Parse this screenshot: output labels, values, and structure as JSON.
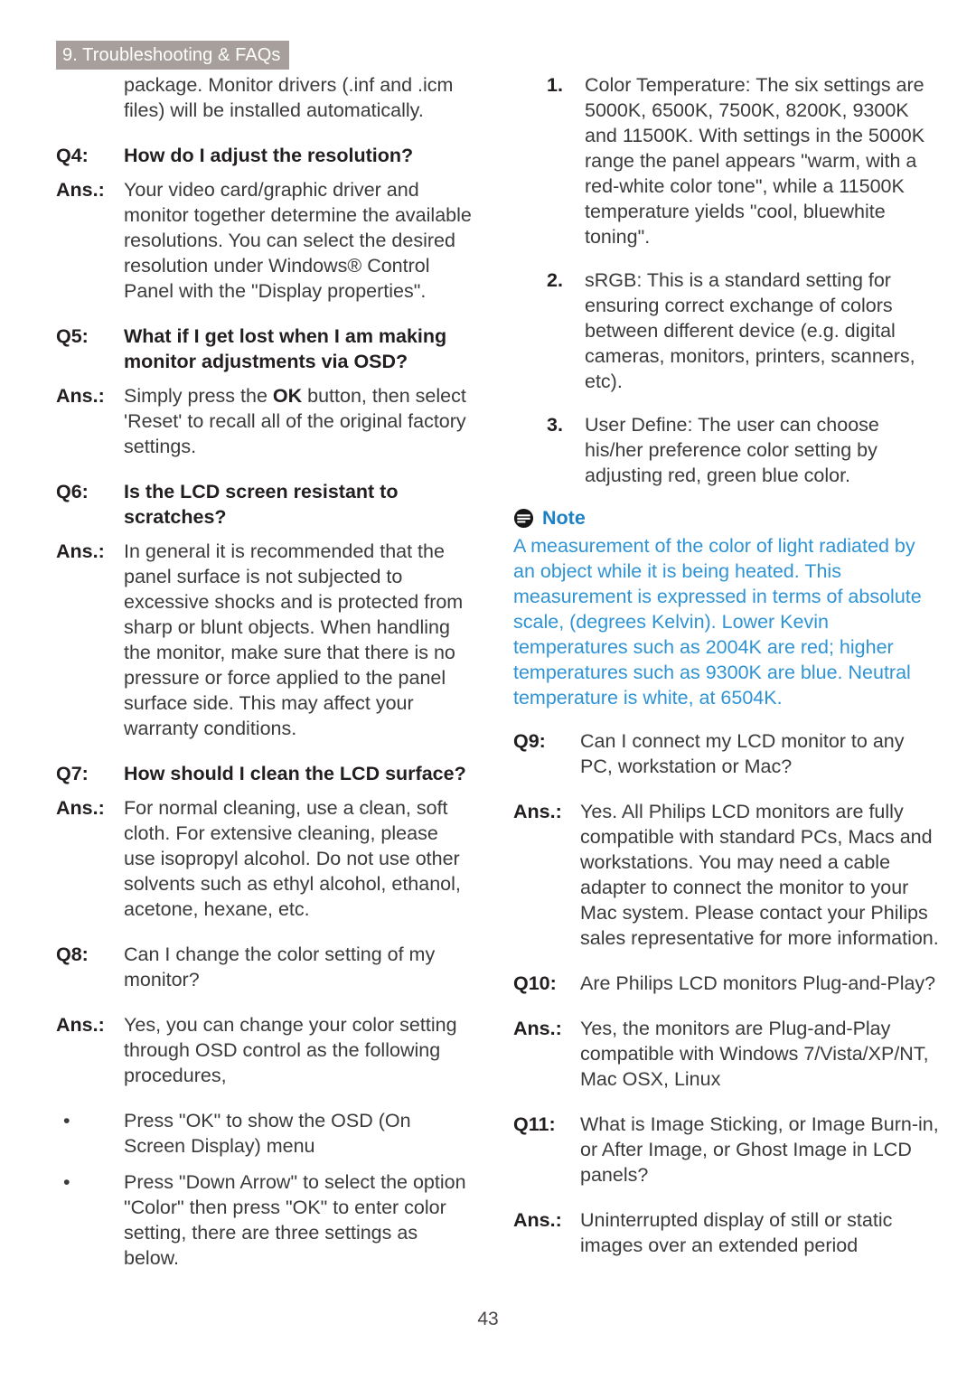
{
  "header": {
    "chapter_label": "9. Troubleshooting & FAQs",
    "band_color": "#a79f9b",
    "text_color": "#ffffff"
  },
  "folio": {
    "page_number": "43"
  },
  "left_column": {
    "continuation_paragraph": "package. Monitor drivers (.inf and .icm files) will be installed automatically.",
    "entries": [
      {
        "label": "Q4:",
        "text": "How do I adjust the resolution?",
        "kind": "question"
      },
      {
        "label": "Ans.:",
        "text": "Your video card/graphic driver and monitor together determine the available resolutions. You can select the desired resolution under Windows® Control Panel with the \"Display properties\".",
        "kind": "answer"
      },
      {
        "label": "Q5:",
        "text": "What if I get lost when I am making monitor adjustments via OSD?",
        "kind": "question"
      },
      {
        "label": "Ans.:",
        "text_before_bold": "Simply press the ",
        "bold_word": "OK",
        "text_after_bold": " button, then select 'Reset' to recall all of the original factory settings.",
        "kind": "answer-with-bold"
      },
      {
        "label": "Q6:",
        "text": "Is the LCD screen resistant to scratches?",
        "kind": "question"
      },
      {
        "label": "Ans.:",
        "text": "In general it is recommended that the panel surface is not subjected to excessive shocks and is protected from sharp or blunt objects. When handling the monitor, make sure that there is no pressure or force applied to the panel surface side. This may affect your warranty conditions.",
        "kind": "answer"
      },
      {
        "label": "Q7:",
        "text": "How should I clean the LCD surface?",
        "kind": "question"
      },
      {
        "label": "Ans.:",
        "text": "For normal cleaning, use a clean, soft cloth. For extensive cleaning, please use isopropyl alcohol. Do not use other solvents such as ethyl alcohol, ethanol, acetone, hexane, etc.",
        "kind": "answer"
      },
      {
        "label": "Q8:",
        "text": "Can I change the color setting of my monitor?",
        "kind": "answer"
      },
      {
        "label": "Ans.:",
        "text": "Yes, you can change your color setting through OSD control as the following procedures,",
        "kind": "answer"
      }
    ],
    "bullets": [
      {
        "marker": "•",
        "text": "Press \"OK\" to show the OSD (On Screen Display) menu"
      },
      {
        "marker": "•",
        "text": "Press \"Down Arrow\" to select the option \"Color\" then press \"OK\" to enter color setting, there are three settings as below."
      }
    ]
  },
  "right_column": {
    "numbered_items": [
      {
        "marker": "1.",
        "text": "Color Temperature: The six settings are 5000K, 6500K, 7500K, 8200K, 9300K and 11500K. With settings in the 5000K range the panel appears \"warm, with a red-white color tone\", while a 11500K temperature yields \"cool, bluewhite toning\"."
      },
      {
        "marker": "2.",
        "text": "sRGB: This is a standard setting for ensuring correct exchange of colors between different device (e.g. digital cameras, monitors, printers, scanners, etc)."
      },
      {
        "marker": "3.",
        "text": "User Define: The user can choose his/her preference color setting by adjusting red, green blue color."
      }
    ],
    "note": {
      "icon": "note-circle-icon",
      "title": "Note",
      "title_color": "#1b80c4",
      "body_color": "#2f93d4",
      "body": "A measurement of the color of light radiated by an object while it is being heated. This measurement is expressed in terms of absolute scale, (degrees Kelvin). Lower Kevin temperatures such as 2004K are red; higher temperatures such as 9300K are blue. Neutral temperature is white, at 6504K."
    },
    "entries": [
      {
        "label": "Q9:",
        "text": "Can I connect my LCD monitor to any PC, workstation or Mac?",
        "kind": "answer"
      },
      {
        "label": "Ans.:",
        "text": "Yes. All Philips LCD monitors are fully compatible with standard PCs, Macs and workstations. You may need a cable adapter to connect the monitor to your Mac system. Please contact your Philips sales representative for more information.",
        "kind": "answer"
      },
      {
        "label": "Q10:",
        "text": "Are Philips LCD monitors Plug-and-Play?",
        "kind": "answer"
      },
      {
        "label": "Ans.:",
        "text": "Yes, the monitors are Plug-and-Play compatible with Windows 7/Vista/XP/NT, Mac OSX, Linux",
        "kind": "answer"
      },
      {
        "label": "Q11:",
        "text": "What is Image Sticking, or Image Burn-in, or After Image, or Ghost Image in LCD panels?",
        "kind": "answer"
      },
      {
        "label": "Ans.:",
        "text": "Uninterrupted display of still or static images over an extended period",
        "kind": "answer"
      }
    ]
  }
}
